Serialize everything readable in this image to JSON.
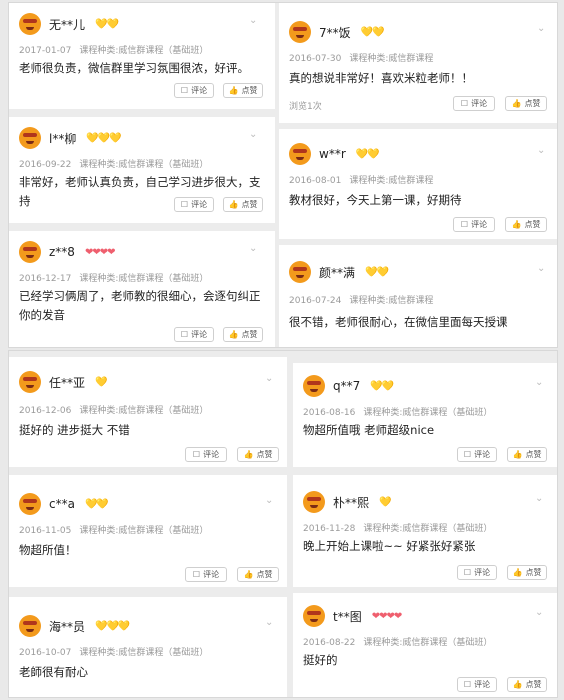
{
  "labels": {
    "comment": "评论",
    "like": "点赞",
    "views": "浏览1次"
  },
  "chevron": "⌄",
  "icons": {
    "comment": "comment-icon",
    "like": "thumbs-up-icon",
    "avatar": "emoji-avatar-icon",
    "badge_gold": "gold-diamond-icon",
    "badge_pink": "pink-heart-icon"
  },
  "colors": {
    "gold": "#f2b51a",
    "pink": "#ef5f6e",
    "avatar": "#f39a1c"
  },
  "top_left": [
    {
      "name": "无**儿",
      "badges": "💛💛",
      "date": "2017-01-07",
      "course": "课程种类:威信群课程（基础班）",
      "text": "老师很负责，微信群里学习氛围很浓，好评。"
    },
    {
      "name": "l**柳",
      "badges": "💛💛💛",
      "date": "2016-09-22",
      "course": "课程种类:威信群课程（基础班）",
      "text": "非常好，老师认真负责，自己学习进步很大，支持"
    },
    {
      "name": "z**8",
      "badges": "❤❤❤❤",
      "date": "2016-12-17",
      "course": "课程种类:威信群课程（基础班）",
      "text": "已经学习俩周了，老师教的很细心，会逐句纠正你的发音"
    }
  ],
  "top_right": [
    {
      "name": "7**饭",
      "badges": "💛💛",
      "date": "2016-07-30",
      "course": "课程种类:威信群课程",
      "text": "真的想说非常好！喜欢米粒老师！！"
    },
    {
      "name": "w**r",
      "badges": "💛💛",
      "date": "2016-08-01",
      "course": "课程种类:威信群课程",
      "text": "教材很好，今天上第一课，好期待"
    },
    {
      "name": "颜**满",
      "badges": "💛💛",
      "date": "2016-07-24",
      "course": "课程种类:威信群课程",
      "text": "很不错，老师很耐心，在微信里面每天授课"
    }
  ],
  "bottom_left": [
    {
      "name": "任**亚",
      "badges": "💛",
      "date": "2016-12-06",
      "course": "课程种类:威信群课程（基础班）",
      "text": "挺好的 进步挺大 不错"
    },
    {
      "name": "c**a",
      "badges": "💛💛",
      "date": "2016-11-05",
      "course": "课程种类:威信群课程（基础班）",
      "text": "物超所值！"
    },
    {
      "name": "海**员",
      "badges": "💛💛💛",
      "date": "2016-10-07",
      "course": "课程种类:威信群课程（基础班）",
      "text": "老師很有耐心"
    }
  ],
  "bottom_right": [
    {
      "name": "q**7",
      "badges": "💛💛",
      "date": "2016-08-16",
      "course": "课程种类:威信群课程（基础班）",
      "text": "物超所值哦 老师超级nice"
    },
    {
      "name": "朴**熙",
      "badges": "💛",
      "date": "2016-11-28",
      "course": "课程种类:威信群课程（基础班）",
      "text": "晚上开始上课啦~~ 好紧张好紧张"
    },
    {
      "name": "t**图",
      "badges": "❤❤❤❤",
      "date": "2016-08-22",
      "course": "课程种类:威信群课程（基础班）",
      "text": "挺好的"
    }
  ]
}
